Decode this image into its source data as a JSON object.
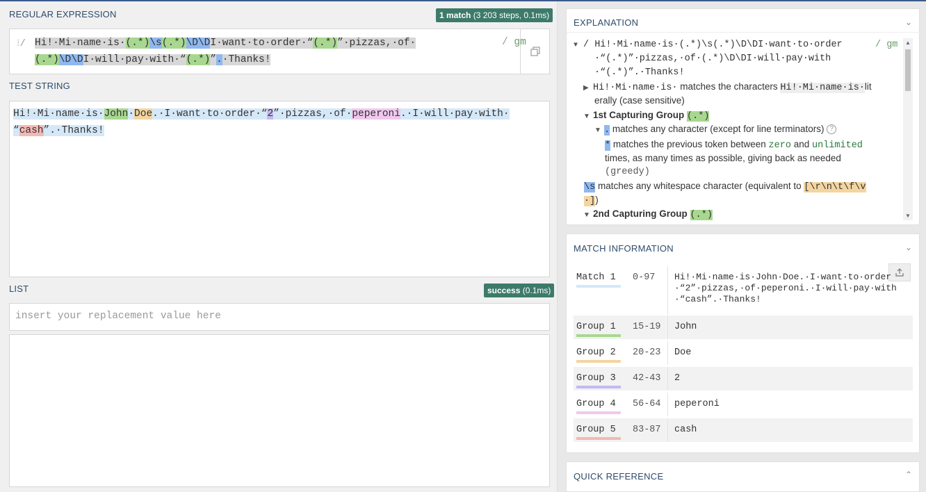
{
  "regex": {
    "label": "REGULAR EXPRESSION",
    "badge_count": "1 match",
    "badge_detail": "(3 203 steps, 0.1ms)",
    "delimiter": "/",
    "flags": "gm",
    "line1": [
      {
        "t": "Hi!·Mi·name·is·",
        "c": "selbg"
      },
      {
        "t": "(.*)",
        "c": "g1"
      },
      {
        "t": "\\s",
        "c": "tok"
      },
      {
        "t": "(.*)",
        "c": "g1"
      },
      {
        "t": "\\D\\D",
        "c": "tok"
      },
      {
        "t": "I·want·to·order·“",
        "c": "selbg"
      },
      {
        "t": "(.*)",
        "c": "g1"
      },
      {
        "t": "”·pizzas,·of·",
        "c": "selbg"
      }
    ],
    "line2": [
      {
        "t": "(.*)",
        "c": "g1"
      },
      {
        "t": "\\D\\D",
        "c": "tok"
      },
      {
        "t": "I·will·pay·with·“",
        "c": "selbg"
      },
      {
        "t": "(.*)",
        "c": "g1"
      },
      {
        "t": "”",
        "c": "selbg"
      },
      {
        "t": ".",
        "c": "tok"
      },
      {
        "t": "·Thanks!",
        "c": "selbg"
      }
    ]
  },
  "test": {
    "label": "TEST STRING",
    "line1": [
      {
        "t": "Hi!·Mi·name·is·",
        "c": "mbg"
      },
      {
        "t": "John",
        "c": "g1"
      },
      {
        "t": "·",
        "c": "mbg"
      },
      {
        "t": "Doe",
        "c": "g2"
      },
      {
        "t": ".·I·want·to·order·“",
        "c": "mbg"
      },
      {
        "t": "2",
        "c": "g3"
      },
      {
        "t": "”·pizzas,·of·",
        "c": "mbg"
      },
      {
        "t": "peperoni",
        "c": "g4"
      },
      {
        "t": ".·I·will·pay·with·",
        "c": "mbg"
      }
    ],
    "line2": [
      {
        "t": "“",
        "c": "mbg"
      },
      {
        "t": "cash",
        "c": "g5"
      },
      {
        "t": "”.·Thanks!",
        "c": "mbg"
      }
    ]
  },
  "list": {
    "label": "LIST",
    "badge": "success",
    "badge_detail": "(0.1ms)",
    "placeholder": "insert your replacement value here"
  },
  "explanation": {
    "title": "EXPLANATION",
    "regex_line1": "/ Hi!·Mi·name·is·(.*)\\s(.*)\\D\\DI·want·to·order",
    "regex_line2": "·“(.*)”·pizzas,·of·(.*)\\D\\DI·will·pay·with",
    "regex_line3": "·“(.*)”.·Thanks!",
    "flags": "/ gm",
    "literal_code": "Hi!·Mi·name·is·",
    "literal_text1": "matches the characters",
    "literal_cont": "lit",
    "literal_text2": "erally (case sensitive)",
    "group1_title": "1st Capturing Group",
    "group_token": "(.*)",
    "dot": ".",
    "dot_text": "matches any character (except for line terminators)",
    "help": "?",
    "star": "*",
    "star_text1": "matches the previous token between",
    "zero": "zero",
    "and": "and",
    "unlimited": "unlimited",
    "star_text2": "times, as many times as possible, giving back as needed",
    "greedy": "(greedy)",
    "ws_token": "\\s",
    "ws_text": "matches any whitespace character (equivalent to",
    "ws_class1": "[\\r\\n\\t\\f\\v",
    "ws_class2": "·]",
    "ws_close": ")",
    "group2_title": "2nd Capturing Group"
  },
  "match_info": {
    "title": "MATCH INFORMATION",
    "share_icon": "share-icon",
    "rows": [
      {
        "name": "Match 1",
        "range": "0-97",
        "value": "Hi!·Mi·name·is·John·Doe.·I·want·to·order·“2”·pizzas,·of·peperoni.·I·will·pay·with·“cash”.·Thanks!",
        "color": "#d5e8f8"
      },
      {
        "name": "Group 1",
        "range": "15-19",
        "value": "John",
        "color": "#a8d88f"
      },
      {
        "name": "Group 2",
        "range": "20-23",
        "value": "Doe",
        "color": "#f3d5a0"
      },
      {
        "name": "Group 3",
        "range": "42-43",
        "value": "2",
        "color": "#c5b9f0"
      },
      {
        "name": "Group 4",
        "range": "56-64",
        "value": "peperoni",
        "color": "#f0c8ef"
      },
      {
        "name": "Group 5",
        "range": "83-87",
        "value": "cash",
        "color": "#f4b8b3"
      }
    ]
  },
  "quick_ref": {
    "title": "QUICK REFERENCE"
  }
}
